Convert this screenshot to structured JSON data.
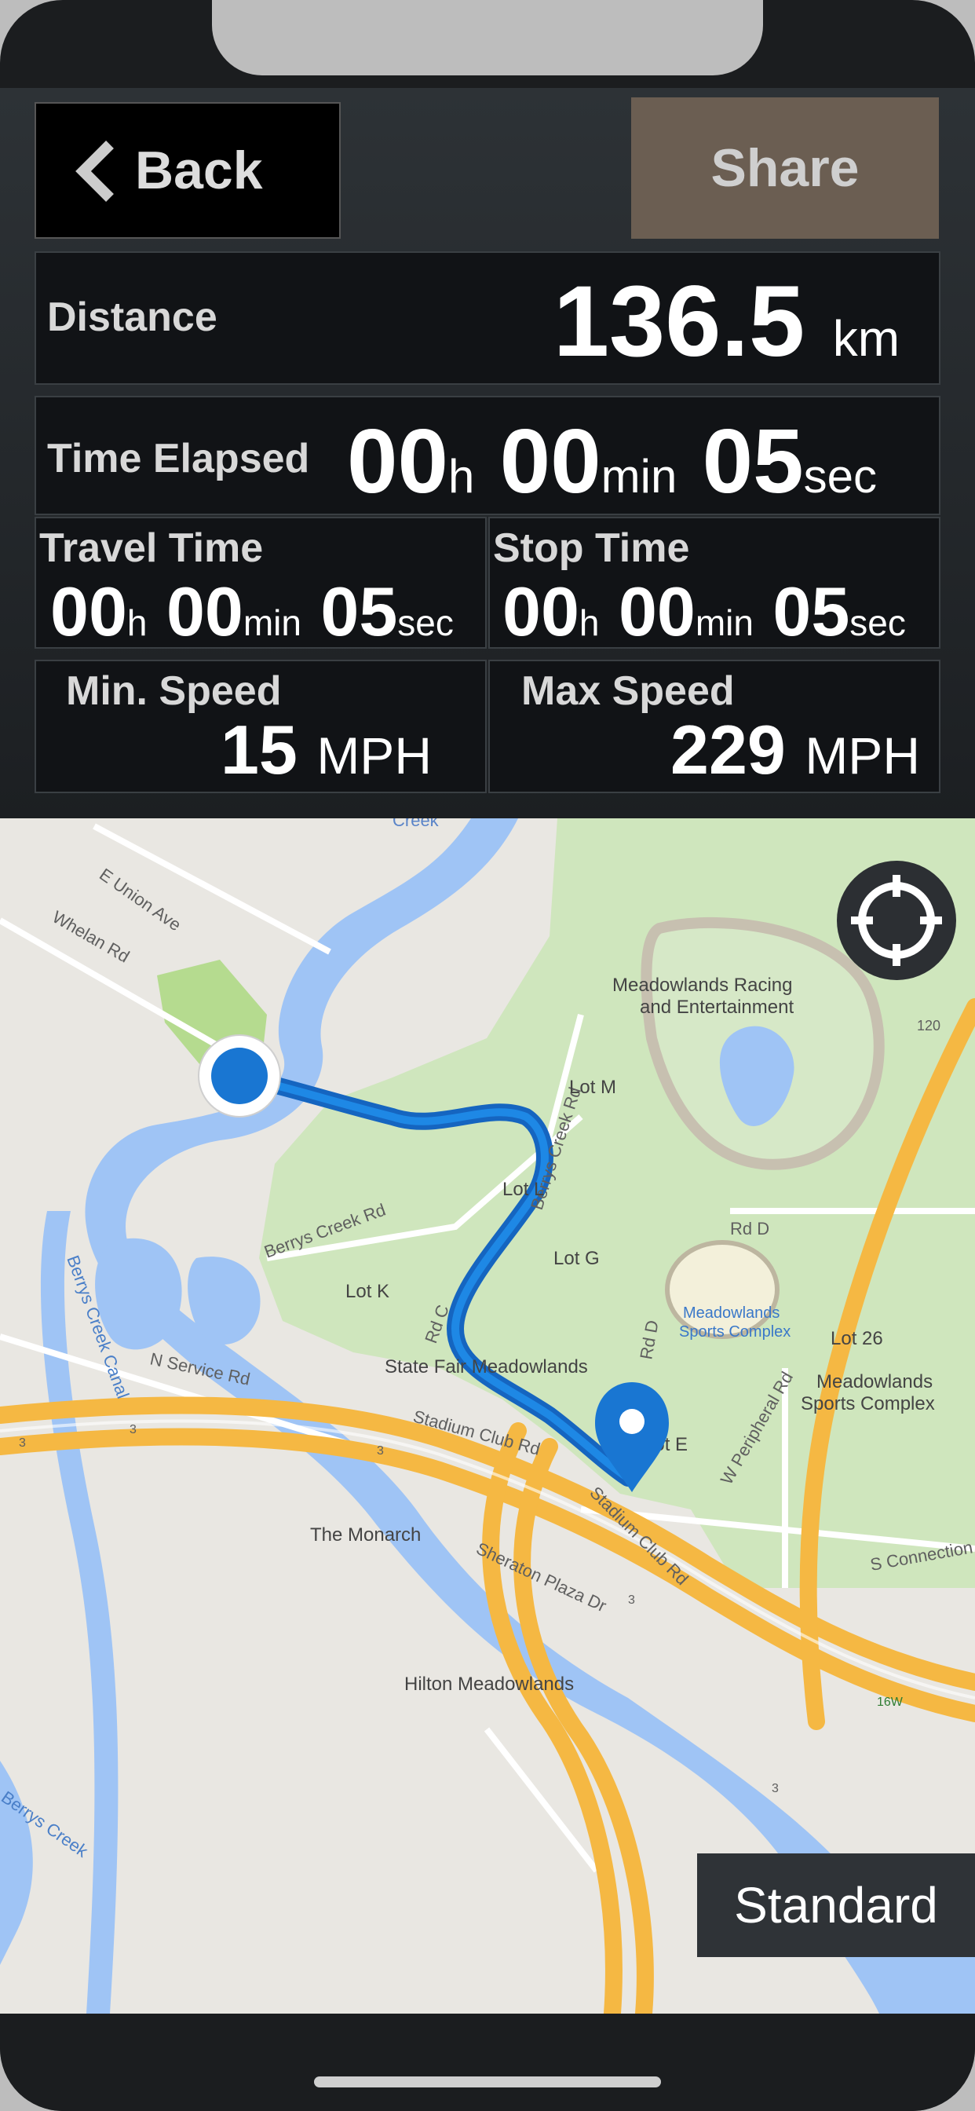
{
  "header": {
    "back_label": "Back",
    "share_label": "Share"
  },
  "stats": {
    "distance_label": "Distance",
    "distance_value": "136.5",
    "distance_unit": "km",
    "time_elapsed_label": "Time Elapsed",
    "time_elapsed": {
      "h": "00",
      "h_unit": "h",
      "min": "00",
      "min_unit": "min",
      "sec": "05",
      "sec_unit": "sec"
    },
    "travel_time_label": "Travel Time",
    "travel_time": {
      "h": "00",
      "h_unit": "h",
      "min": "00",
      "min_unit": "min",
      "sec": "05",
      "sec_unit": "sec"
    },
    "stop_time_label": "Stop Time",
    "stop_time": {
      "h": "00",
      "h_unit": "h",
      "min": "00",
      "min_unit": "min",
      "sec": "05",
      "sec_unit": "sec"
    },
    "min_speed_label": "Min. Speed",
    "min_speed_value": "15",
    "min_speed_unit": "MPH",
    "max_speed_label": "Max Speed",
    "max_speed_value": "229",
    "max_speed_unit": "MPH"
  },
  "map": {
    "labels": {
      "e_union_ave": "E Union Ave",
      "whelan_rd": "Whelan Rd",
      "creek_top": "Creek",
      "meadowlands_racing": "Meadowlands Racing",
      "and_entertainment": "and Entertainment",
      "route_120": "120",
      "berrys_creek_rd_1": "Berrys Creek Rd",
      "lot_m": "Lot M",
      "lot_l": "Lot L",
      "rd_d": "Rd D",
      "berrys_creek_rd_2": "Berrys Creek Rd",
      "lot_g": "Lot G",
      "lot_k": "Lot K",
      "berrys_creek_canal": "Berrys Creek Canal",
      "meadowlands_sports_complex_small_1": "Meadowlands",
      "meadowlands_sports_complex_small_2": "Sports Complex",
      "lot_26": "Lot 26",
      "meadowlands_sports_complex_1": "Meadowlands",
      "meadowlands_sports_complex_2": "Sports Complex",
      "n_service_rd": "N Service Rd",
      "state_fair_meadowlands": "State Fair Meadowlands",
      "rd_c": "Rd C",
      "rd_d_vert": "Rd D",
      "lot_e": "Lot E",
      "w_peripheral_rd": "W Peripheral Rd",
      "stadium_club_rd_1": "Stadium Club Rd",
      "stadium_club_rd_2": "Stadium Club Rd",
      "the_monarch": "The Monarch",
      "sheraton_plaza_dr": "Sheraton Plaza Dr",
      "s_connection": "S Connection",
      "hilton_meadowlands": "Hilton Meadowlands",
      "route_16w": "16W",
      "route_3_a": "3",
      "route_3_b": "3",
      "route_3_c": "3",
      "route_3_d": "3",
      "route_3_e": "3",
      "berrys_creek_bottom": "Berrys Creek"
    },
    "standard_label": "Standard"
  },
  "colors": {
    "accent_blue": "#1976d2",
    "route_blue": "#1565c0",
    "share_bg": "#6b5e52",
    "highway": "#f5b843",
    "water": "#9fc4f5",
    "park": "#cfe6bd"
  }
}
